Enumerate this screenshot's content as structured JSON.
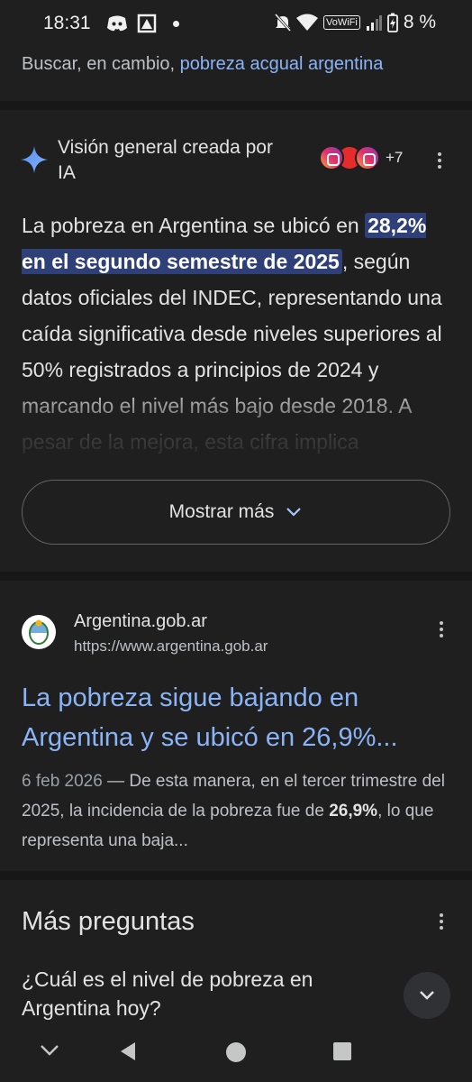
{
  "status_bar": {
    "time": "18:31",
    "wifi_label": "VoWiFi",
    "battery": "8 %"
  },
  "suggestion": {
    "prefix": "Buscar, en cambio,",
    "link": "pobreza acgual argentina"
  },
  "ai_overview": {
    "title": "Visión general creada por IA",
    "sources_more": "+7",
    "body_before": "La pobreza en Argentina se ubicó en ",
    "body_highlight": "28,2% en el segundo semestre de 2025",
    "body_after": ", según datos oficiales del INDEC, representando una caída significativa desde niveles superiores al 50% registrados a principios de 2024 y marcando el nivel más bajo desde 2018. A pesar de la mejora, esta cifra implica",
    "show_more_label": "Mostrar más"
  },
  "result": {
    "site_name": "Argentina.gob.ar",
    "site_url": "https://www.argentina.gob.ar",
    "title": "La pobreza sigue bajando en Argentina y se ubicó en 26,9%...",
    "date": "6 feb 2026",
    "snippet_before": " — De esta manera, en el tercer trimestre del 2025, la incidencia de la pobreza fue de ",
    "snippet_bold": "26,9%",
    "snippet_after": ", lo que representa una baja..."
  },
  "more_questions": {
    "title": "Más preguntas",
    "question": "¿Cuál es el nivel de pobreza en Argentina hoy?"
  },
  "colors": {
    "background": "#1f1f1f",
    "link": "#8ab4f8",
    "highlight": "#2f3f78"
  }
}
